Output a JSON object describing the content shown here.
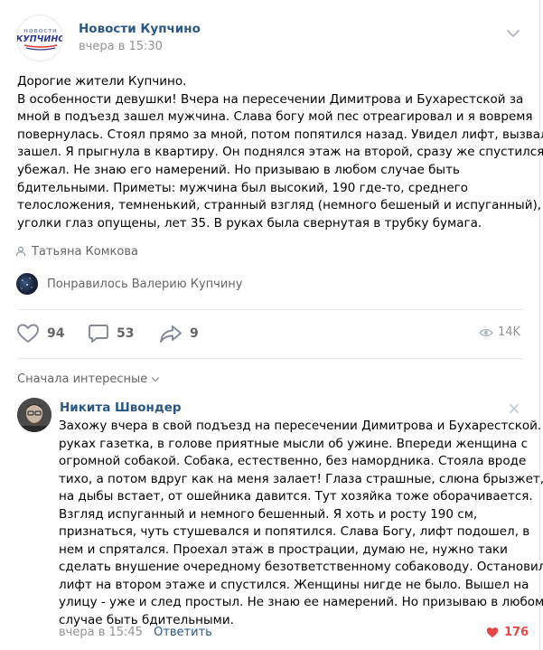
{
  "post": {
    "group_name": "Новости Купчино",
    "logo_text_top": "НОВОСТИ",
    "logo_text_main": "КУПЧИНО",
    "time": "вчера в 15:30",
    "text_lines": [
      "Дорогие жители Купчино.",
      "В особенности девушки! Вчера на пересечении Димитрова и Бухарестской за",
      "мной в подъезд зашел мужчина. Слава богу мой пес отреагировал и я вовремя",
      "повернулась. Стоял прямо за мной, потом попятился назад. Увидел лифт, вызвал,",
      "зашел. Я прыгнула в квартиру. Он поднялся этаж на второй, сразу же спустился и",
      "убежал. Не знаю его намерений. Но призываю в любом случае быть",
      "бдительными. Приметы: мужчина был высокий, 190 где-то, среднего",
      "телосложения, темненький, странный взгляд (немного бешеный и испуганный),",
      "уголки глаз опущены, лет 35. В руках была свернутая в трубку бумага."
    ],
    "author": "Татьяна Комкова",
    "liked_by": "Понравилось Валерию Купчину",
    "likes": "94",
    "comments": "53",
    "shares": "9",
    "views": "14K"
  },
  "comments_section": {
    "sort_label": "Сначала интересные",
    "comment": {
      "author": "Никита Швондер",
      "text_lines": [
        "Захожу вчера в свой подъезд на пересечении Димитрова и Бухарестской. В",
        "руках газетка, в голове приятные мысли об ужине. Впереди женщина с",
        "огромной собакой. Собака, естественно, без намордника. Стояла вроде",
        "тихо, а потом вдруг как на меня залает! Глаза страшные, слюна брызжет,",
        "на дыбы встает, от ошейника давится. Тут хозяйка тоже оборачивается.",
        "Взгляд испуганный и немного бешенный. Я хоть и росту 190 см,",
        "признаться, чуть стушевался и попятился. Слава Богу, лифт подошел, в",
        "нем и спрятался. Проехал этаж в прострации, думаю не, нужно таки",
        "сделать внушение очередному безответственному собаководу. Остановил",
        "лифт на втором этаже и спустился. Женщины нигде не было. Вышел на",
        "улицу - уже и след простыл. Не знаю ее намерений. Но призываю в любом",
        "случае быть бдительными."
      ],
      "time": "вчера в 15:45",
      "reply_label": "Ответить",
      "likes": "176"
    }
  },
  "colors": {
    "link": "#2a5885",
    "secondary": "#656565",
    "muted": "#939393",
    "like_red": "#e64646",
    "divider": "#e7e8ec"
  },
  "icons": [
    "chevron-down-icon",
    "user-icon",
    "heart-icon",
    "comment-icon",
    "share-icon",
    "eye-icon",
    "close-icon",
    "heart-filled-icon"
  ]
}
